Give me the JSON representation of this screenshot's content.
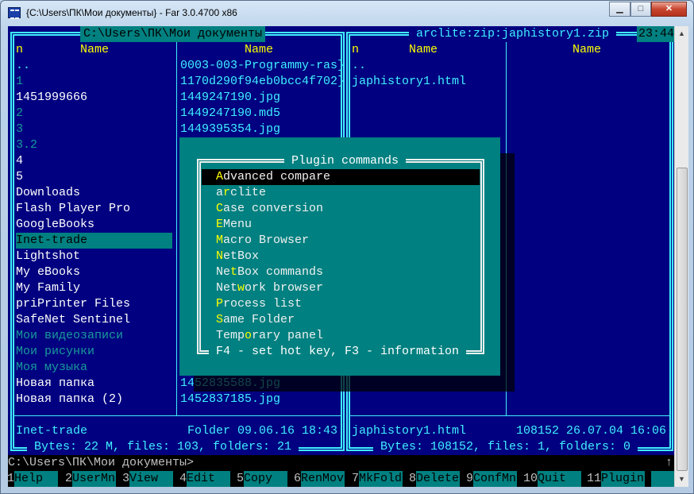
{
  "window": {
    "title": "{C:\\Users\\ПК\\Мои документы} - Far 3.0.4700 x86",
    "buttons": {
      "minimize": "▁",
      "maximize": "□",
      "close": "✕"
    }
  },
  "colors": {
    "panel_bg": "#000080",
    "text_cyan": "#40f0ff",
    "text_white": "#ffffff",
    "text_hidden": "#1a9a9a",
    "hotkey": "#ffff00",
    "dialog_bg": "#008080",
    "highlight": "#008080"
  },
  "left_panel": {
    "title": "C:\\Users\\ПК\\Мои документы",
    "header_n": "n",
    "header_name1": "Name",
    "header_name2": "Name",
    "col1": [
      {
        "name": "..",
        "color": "cyan"
      },
      {
        "name": "1",
        "color": "hidden"
      },
      {
        "name": "1451999666",
        "color": "white"
      },
      {
        "name": "2",
        "color": "hidden"
      },
      {
        "name": "3",
        "color": "hidden"
      },
      {
        "name": "3.2",
        "color": "hidden"
      },
      {
        "name": "4",
        "color": "white"
      },
      {
        "name": "5",
        "color": "white"
      },
      {
        "name": "Downloads",
        "color": "white"
      },
      {
        "name": "Flash Player Pro",
        "color": "white"
      },
      {
        "name": "GoogleBooks",
        "color": "white"
      },
      {
        "name": "Inet-trade",
        "color": "white",
        "selected": true
      },
      {
        "name": "Lightshot",
        "color": "white"
      },
      {
        "name": "My eBooks",
        "color": "white"
      },
      {
        "name": "My Family",
        "color": "white"
      },
      {
        "name": "priPrinter Files",
        "color": "white"
      },
      {
        "name": "SafeNet Sentinel",
        "color": "white"
      },
      {
        "name": "Мои видеозаписи",
        "color": "hidden"
      },
      {
        "name": "Мои рисунки",
        "color": "hidden"
      },
      {
        "name": "Моя музыка",
        "color": "hidden"
      },
      {
        "name": "Новая папка",
        "color": "white"
      },
      {
        "name": "Новая папка (2)",
        "color": "white"
      }
    ],
    "col2_top": [
      "0003-003-Programmy-ras}",
      "1170d290f94eb0bcc4f702}",
      "1449247190.jpg",
      "1449247190.md5",
      "1449395354.jpg"
    ],
    "col2_bottom": [
      "1452835588.jpg",
      "1452837185.jpg"
    ],
    "info_name": "Inet-trade",
    "info_details": "Folder 09.06.16 18:43",
    "totals": " Bytes: 22 M, files: 103, folders: 21 "
  },
  "right_panel": {
    "title": " arclite:zip:japhistory1.zip ",
    "clock": "23:44",
    "header_n": "n",
    "header_name1": "Name",
    "header_name2": "Name",
    "col1": [
      "..",
      "japhistory1.html"
    ],
    "info_name": "japhistory1.html",
    "info_details": "108152 26.07.04 16:06",
    "totals": " Bytes: 108152, files: 1, folders: 0 "
  },
  "dialog": {
    "title": " Plugin commands ",
    "items": [
      {
        "pre": "",
        "hot": "A",
        "post": "dvanced compare",
        "selected": true
      },
      {
        "pre": "a",
        "hot": "r",
        "post": "clite"
      },
      {
        "pre": "",
        "hot": "C",
        "post": "ase conversion"
      },
      {
        "pre": "",
        "hot": "E",
        "post": "Menu"
      },
      {
        "pre": "",
        "hot": "M",
        "post": "acro Browser"
      },
      {
        "pre": "",
        "hot": "N",
        "post": "etBox"
      },
      {
        "pre": "Ne",
        "hot": "t",
        "post": "Box commands"
      },
      {
        "pre": "Net",
        "hot": "w",
        "post": "ork browser"
      },
      {
        "pre": "",
        "hot": "P",
        "post": "rocess list"
      },
      {
        "pre": "",
        "hot": "S",
        "post": "ame Folder"
      },
      {
        "pre": "Temp",
        "hot": "o",
        "post": "rary panel"
      }
    ],
    "footer": " F4 - set hot key, F3 - information "
  },
  "command_line": {
    "prompt": "C:\\Users\\ПК\\Мои документы>",
    "scroll_indicator": "↑"
  },
  "keybar": [
    {
      "num": "1",
      "label": "Help"
    },
    {
      "num": "2",
      "label": "UserMn"
    },
    {
      "num": "3",
      "label": "View"
    },
    {
      "num": "4",
      "label": "Edit"
    },
    {
      "num": "5",
      "label": "Copy"
    },
    {
      "num": "6",
      "label": "RenMov"
    },
    {
      "num": "7",
      "label": "MkFold"
    },
    {
      "num": "8",
      "label": "Delete"
    },
    {
      "num": "9",
      "label": "ConfMn"
    },
    {
      "num": "10",
      "label": "Quit"
    },
    {
      "num": "11",
      "label": "Plugin"
    },
    {
      "num": "",
      "label": ""
    }
  ],
  "scrollbar": {
    "up": "▲",
    "down": "▼"
  }
}
